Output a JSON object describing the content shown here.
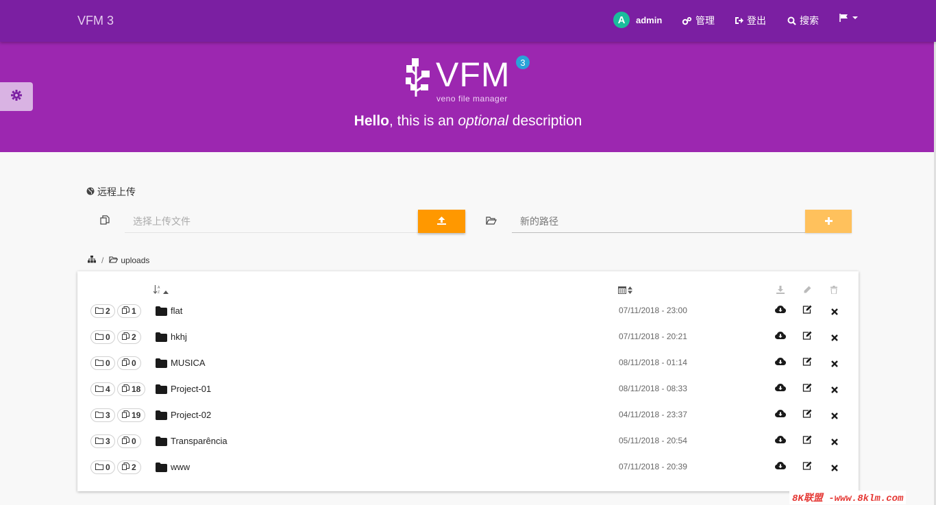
{
  "navbar": {
    "brand": "VFM 3",
    "user": {
      "initial": "A",
      "name": "admin"
    },
    "admin_label": "管理",
    "logout_label": "登出",
    "search_label": "搜索",
    "lang_icon": "flag-icon"
  },
  "hero": {
    "logo_word": "VFM",
    "logo_tag": "veno file manager",
    "logo_badge": "3",
    "tagline_bold": "Hello",
    "tagline_mid": ", this is an ",
    "tagline_italic": "optional",
    "tagline_end": " description"
  },
  "upload": {
    "remote_label": "远程上传",
    "file_placeholder": "选择上传文件",
    "path_placeholder": "新的路径"
  },
  "breadcrumb": {
    "folder": "uploads"
  },
  "table": {
    "rows": [
      {
        "dirs": "2",
        "files": "1",
        "name": "flat",
        "date": "07/11/2018 - 23:00"
      },
      {
        "dirs": "0",
        "files": "2",
        "name": "hkhj",
        "date": "07/11/2018 - 20:21"
      },
      {
        "dirs": "0",
        "files": "0",
        "name": "MUSICA",
        "date": "08/11/2018 - 01:14"
      },
      {
        "dirs": "4",
        "files": "18",
        "name": "Project-01",
        "date": "08/11/2018 - 08:33"
      },
      {
        "dirs": "3",
        "files": "19",
        "name": "Project-02",
        "date": "04/11/2018 - 23:37"
      },
      {
        "dirs": "3",
        "files": "0",
        "name": "Transparência",
        "date": "05/11/2018 - 20:54"
      },
      {
        "dirs": "0",
        "files": "2",
        "name": "www",
        "date": "07/11/2018 - 20:39"
      }
    ]
  },
  "watermark": "8K联盟 -www.8klm.com",
  "colors": {
    "navbar": "#7b1fa2",
    "hero": "#9c27b0",
    "upload_button": "#ff9800",
    "add_button": "#ffc15c",
    "avatar": "#1abc9c",
    "badge": "#2aa3d8"
  }
}
